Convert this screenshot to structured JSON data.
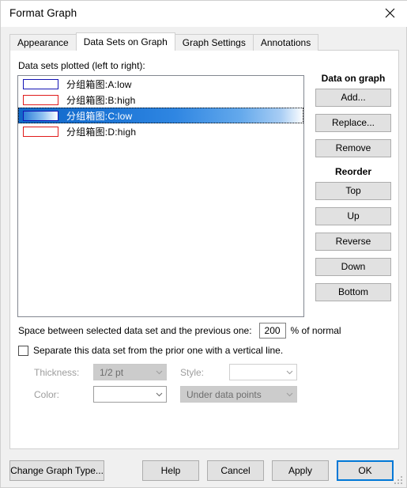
{
  "window": {
    "title": "Format Graph",
    "close_icon": "close-icon"
  },
  "tabs": [
    {
      "label": "Appearance",
      "active": false
    },
    {
      "label": "Data Sets on Graph",
      "active": true
    },
    {
      "label": "Graph Settings",
      "active": false
    },
    {
      "label": "Annotations",
      "active": false
    }
  ],
  "datasets": {
    "label": "Data sets plotted (left to right):",
    "items": [
      {
        "label": "分组箱图:A:low",
        "swatch_border": "#1414b4",
        "selected": false
      },
      {
        "label": "分组箱图:B:high",
        "swatch_border": "#e01b1b",
        "selected": false
      },
      {
        "label": "分组箱图:C:low",
        "swatch_border": "#1414b4",
        "selected": true
      },
      {
        "label": "分组箱图:D:high",
        "swatch_border": "#e01b1b",
        "selected": false
      }
    ]
  },
  "side": {
    "data_on_graph_heading": "Data on graph",
    "data_buttons": [
      "Add...",
      "Replace...",
      "Remove"
    ],
    "reorder_heading": "Reorder",
    "reorder_buttons": [
      "Top",
      "Up",
      "Reverse",
      "Down",
      "Bottom"
    ]
  },
  "spacing": {
    "label": "Space between selected data set and the previous one:",
    "value": "200",
    "suffix": "%  of normal"
  },
  "separate": {
    "checkbox_label": "Separate this data set from the prior one with a vertical line.",
    "checked": false,
    "thickness_label": "Thickness:",
    "thickness_value": "1/2 pt",
    "style_label": "Style:",
    "style_value": "",
    "color_label": "Color:",
    "color_value": "",
    "layer_value": "Under data points"
  },
  "footer": {
    "change_graph_type": "Change Graph Type...",
    "help": "Help",
    "cancel": "Cancel",
    "apply": "Apply",
    "ok": "OK"
  },
  "colors": {
    "accent": "#0078d7",
    "selection_blue": "#1268c8",
    "dialog_bg": "#f0f0f0",
    "panel_bg": "#ffffff"
  }
}
